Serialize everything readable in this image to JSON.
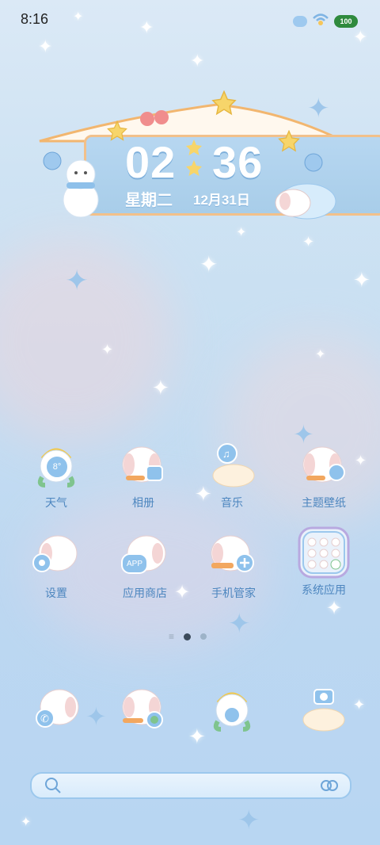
{
  "status_bar": {
    "time": "8:16",
    "battery": "100"
  },
  "clock_widget": {
    "hours": "02",
    "minutes": "36",
    "weekday": "星期二",
    "date": "12月31日"
  },
  "apps_row1": [
    {
      "label": "天气",
      "icon": "weather-icon",
      "badge": "8°"
    },
    {
      "label": "相册",
      "icon": "gallery-icon"
    },
    {
      "label": "音乐",
      "icon": "music-icon"
    },
    {
      "label": "主题壁纸",
      "icon": "theme-wallpaper-icon"
    }
  ],
  "apps_row2": [
    {
      "label": "设置",
      "icon": "settings-icon"
    },
    {
      "label": "应用商店",
      "icon": "app-store-icon",
      "badge": "APP"
    },
    {
      "label": "手机管家",
      "icon": "phone-manager-icon"
    },
    {
      "label": "系统应用",
      "icon": "system-apps-folder-icon"
    }
  ],
  "dock": [
    {
      "icon": "phone-icon"
    },
    {
      "icon": "messages-icon"
    },
    {
      "icon": "browser-icon"
    },
    {
      "icon": "camera-icon"
    }
  ],
  "search_bar": {
    "icon_left": "search-icon",
    "icon_right": "voice-scan-icon"
  },
  "colors": {
    "accent": "#4d86bf",
    "background": "#c6def2"
  }
}
